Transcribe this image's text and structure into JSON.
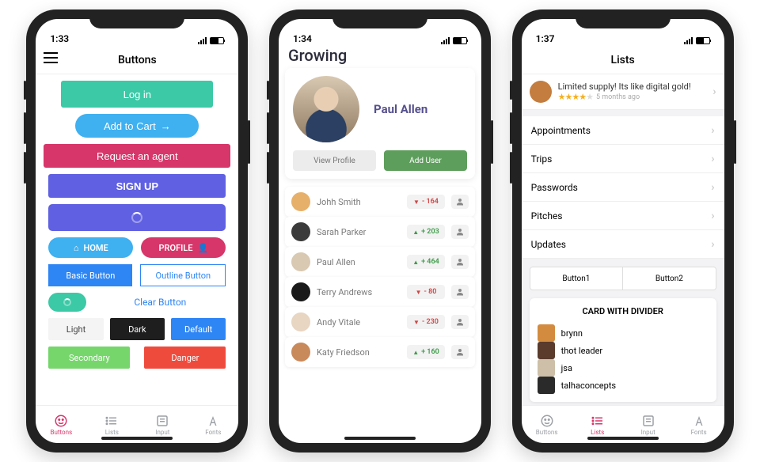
{
  "phone1": {
    "time": "1:33",
    "title": "Buttons",
    "login": "Log in",
    "addToCart": "Add to Cart",
    "requestAgent": "Request an agent",
    "signUp": "SIGN UP",
    "home": "HOME",
    "profile": "PROFILE",
    "basic": "Basic Button",
    "outline": "Outline Button",
    "clear": "Clear Button",
    "light": "Light",
    "dark": "Dark",
    "default": "Default",
    "secondary": "Secondary",
    "danger": "Danger",
    "tabs": [
      "Buttons",
      "Lists",
      "Input",
      "Fonts"
    ]
  },
  "phone2": {
    "time": "1:34",
    "title": "Growing",
    "profileName": "Paul Allen",
    "viewProfile": "View Profile",
    "addUser": "Add User",
    "members": [
      {
        "name": "Johh Smith",
        "score": "- 164",
        "dir": "down",
        "color": "#e7b06a"
      },
      {
        "name": "Sarah Parker",
        "score": "+ 203",
        "dir": "up",
        "color": "#3b3b3b"
      },
      {
        "name": "Paul Allen",
        "score": "+ 464",
        "dir": "up",
        "color": "#d9c9b2"
      },
      {
        "name": "Terry Andrews",
        "score": "- 80",
        "dir": "down",
        "color": "#1a1a1a"
      },
      {
        "name": "Andy Vitale",
        "score": "- 230",
        "dir": "down",
        "color": "#e8d5c2"
      },
      {
        "name": "Katy Friedson",
        "score": "+ 160",
        "dir": "up",
        "color": "#c98a5b"
      }
    ]
  },
  "phone3": {
    "time": "1:37",
    "title": "Lists",
    "promo": {
      "title": "Limited supply! Its like digital gold!",
      "subtitle": "5 months ago"
    },
    "rows": [
      "Appointments",
      "Trips",
      "Passwords",
      "Pitches",
      "Updates"
    ],
    "button1": "Button1",
    "button2": "Button2",
    "cardTitle": "CARD WITH DIVIDER",
    "people": [
      {
        "name": "brynn",
        "color": "#d38b3f"
      },
      {
        "name": "thot leader",
        "color": "#5a3b2c"
      },
      {
        "name": "jsa",
        "color": "#cdbfa8"
      },
      {
        "name": "talhaconcepts",
        "color": "#2a2a2a"
      }
    ],
    "tabs": [
      "Buttons",
      "Lists",
      "Input",
      "Fonts"
    ]
  }
}
